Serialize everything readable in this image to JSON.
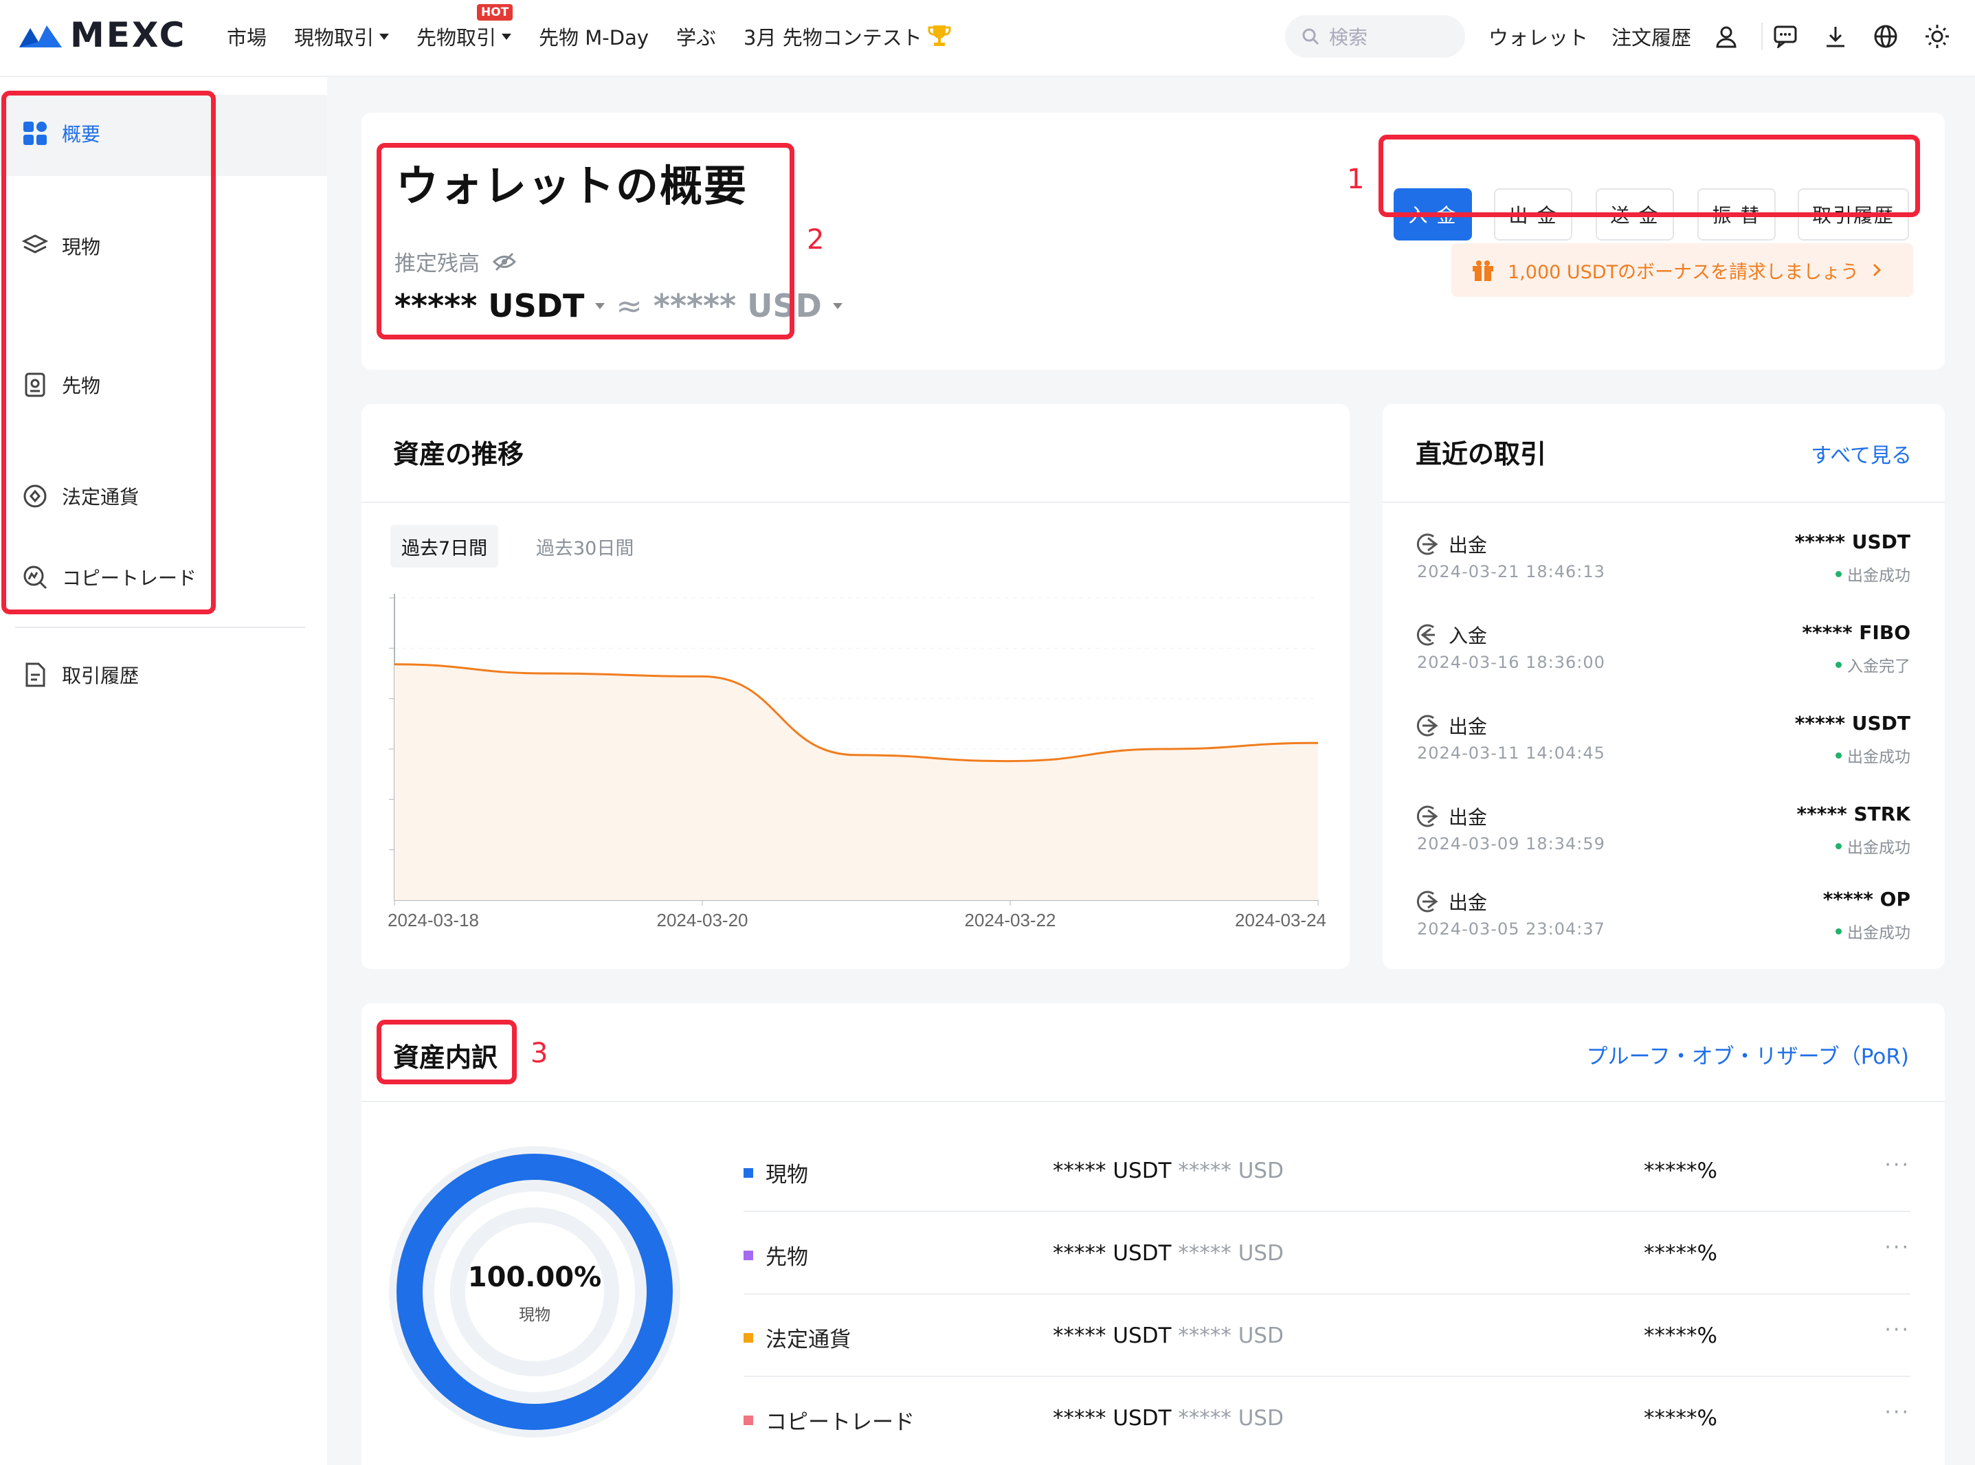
{
  "header": {
    "brand": "MEXC",
    "nav": [
      {
        "label": "市場"
      },
      {
        "label": "現物取引"
      },
      {
        "label": "先物取引",
        "badge": "HOT"
      },
      {
        "label": "先物 M-Day"
      },
      {
        "label": "学ぶ"
      },
      {
        "label": "3月 先物コンテスト"
      }
    ],
    "search_placeholder": "検索",
    "links": [
      "ウォレット",
      "注文履歴"
    ]
  },
  "sidebar": {
    "items": [
      {
        "label": "概要",
        "icon": "grid-icon"
      },
      {
        "label": "現物",
        "icon": "layers-icon"
      },
      {
        "label": "先物",
        "icon": "futures-icon"
      },
      {
        "label": "法定通貨",
        "icon": "fiat-icon"
      },
      {
        "label": "コピートレード",
        "icon": "copy-trade-icon"
      },
      {
        "label": "取引履歴",
        "icon": "document-icon"
      }
    ]
  },
  "overview": {
    "title": "ウォレットの概要",
    "balance_label": "推定残高",
    "balance_usdt": "***** USDT",
    "approx": "≈",
    "balance_usd": "***** USD",
    "buttons": [
      "入 金",
      "出 金",
      "送 金",
      "振 替",
      "取引履歴"
    ],
    "bonus": "1,000 USDTのボーナスを請求しましょう"
  },
  "annotations": [
    "1",
    "2",
    "3"
  ],
  "trend": {
    "title": "資産の推移",
    "tabs": [
      "過去7日間",
      "過去30日間"
    ],
    "active_tab": 0
  },
  "chart_data": {
    "type": "area",
    "x_tick_labels": [
      "2024-03-18",
      "2024-03-20",
      "2024-03-22",
      "2024-03-24"
    ],
    "note_values": "y-axis unlabeled; values are relative levels",
    "x": [
      "2024-03-18",
      "2024-03-19",
      "2024-03-20",
      "2024-03-21",
      "2024-03-22",
      "2024-03-23",
      "2024-03-24"
    ],
    "y": [
      0.78,
      0.75,
      0.74,
      0.48,
      0.46,
      0.5,
      0.52
    ],
    "ylim": [
      0,
      1
    ],
    "color": "#f07d1e",
    "fill": "#fdf4ec",
    "grid": true
  },
  "recent": {
    "title": "直近の取引",
    "view_all": "すべて見る",
    "items": [
      {
        "type": "出金",
        "time": "2024-03-21 18:46:13",
        "amount": "***** USDT",
        "status": "出金成功"
      },
      {
        "type": "入金",
        "time": "2024-03-16 18:36:00",
        "amount": "***** FIBO",
        "status": "入金完了"
      },
      {
        "type": "出金",
        "time": "2024-03-11 14:04:45",
        "amount": "***** USDT",
        "status": "出金成功"
      },
      {
        "type": "出金",
        "time": "2024-03-09 18:34:59",
        "amount": "***** STRK",
        "status": "出金成功"
      },
      {
        "type": "出金",
        "time": "2024-03-05 23:04:37",
        "amount": "***** OP",
        "status": "出金成功"
      }
    ]
  },
  "breakdown": {
    "title": "資産内訳",
    "por_link": "プルーフ・オブ・リザーブ（PoR)",
    "donut_pct": "100.00%",
    "donut_label": "現物",
    "rows": [
      {
        "name": "現物",
        "color": "#1e6fe8",
        "usdt": "***** USDT",
        "usd": "***** USD",
        "pct": "*****%"
      },
      {
        "name": "先物",
        "color": "#a46bf2",
        "usdt": "***** USDT",
        "usd": "***** USD",
        "pct": "*****%"
      },
      {
        "name": "法定通貨",
        "color": "#f5a312",
        "usdt": "***** USDT",
        "usd": "***** USD",
        "pct": "*****%"
      },
      {
        "name": "コピートレード",
        "color": "#f07580",
        "usdt": "***** USDT",
        "usd": "***** USD",
        "pct": "*****%"
      }
    ],
    "more": "···"
  }
}
